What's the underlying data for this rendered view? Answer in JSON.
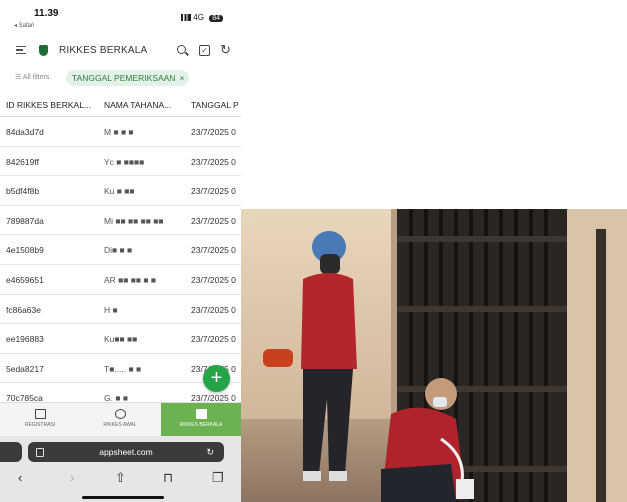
{
  "status_bar": {
    "time": "11.39",
    "back_app": "◂ Safari",
    "network": "4G",
    "battery": "84"
  },
  "app_bar": {
    "title": "RIKKES BERKALA"
  },
  "filters": {
    "all_label": "All filters",
    "chip_label": "TANGGAL PEMERIKSAAN"
  },
  "table": {
    "headers": [
      "ID RIKKES BERKAL...",
      "NAMA TAHANA...",
      "TANGGAL P"
    ],
    "rows": [
      {
        "id": "84da3d7d",
        "name": "M ■ ■ ■",
        "date": "23/7/2025 0"
      },
      {
        "id": "842619ff",
        "name": "Yc      ■ ■■■■",
        "date": "23/7/2025 0"
      },
      {
        "id": "b5df4f8b",
        "name": "Ku       ■ ■■",
        "date": "23/7/2025 0"
      },
      {
        "id": "789887da",
        "name": "Mi ■■ ■■ ■■ ■■",
        "date": "23/7/2025 0"
      },
      {
        "id": "4e1508b9",
        "name": "Di■     ■    ■",
        "date": "23/7/2025 0"
      },
      {
        "id": "e4659651",
        "name": "AR ■■ ■■ ■  ■",
        "date": "23/7/2025 0"
      },
      {
        "id": "fc86a63e",
        "name": "H  ■",
        "date": "23/7/2025 0"
      },
      {
        "id": "ee196883",
        "name": "Ku■■  ■■",
        "date": "23/7/2025 0"
      },
      {
        "id": "5eda8217",
        "name": "T■.....   ■ ■",
        "date": "23/7/2025 0"
      },
      {
        "id": "70c785ca",
        "name": "G.   ■    ■",
        "date": "23/7/2025 0"
      }
    ]
  },
  "fab": {
    "label": "+"
  },
  "bottom_nav": [
    {
      "label": "REGISTRASI"
    },
    {
      "label": "RIKKES AWAL"
    },
    {
      "label": "RIKKES BERKALA"
    }
  ],
  "browser": {
    "url": "appsheet.com"
  },
  "colors": {
    "accent": "#22a447",
    "nav_active": "#6cb152",
    "chip_bg": "#e3f1e6"
  },
  "photo": {
    "description_icon": "photo-icon"
  }
}
